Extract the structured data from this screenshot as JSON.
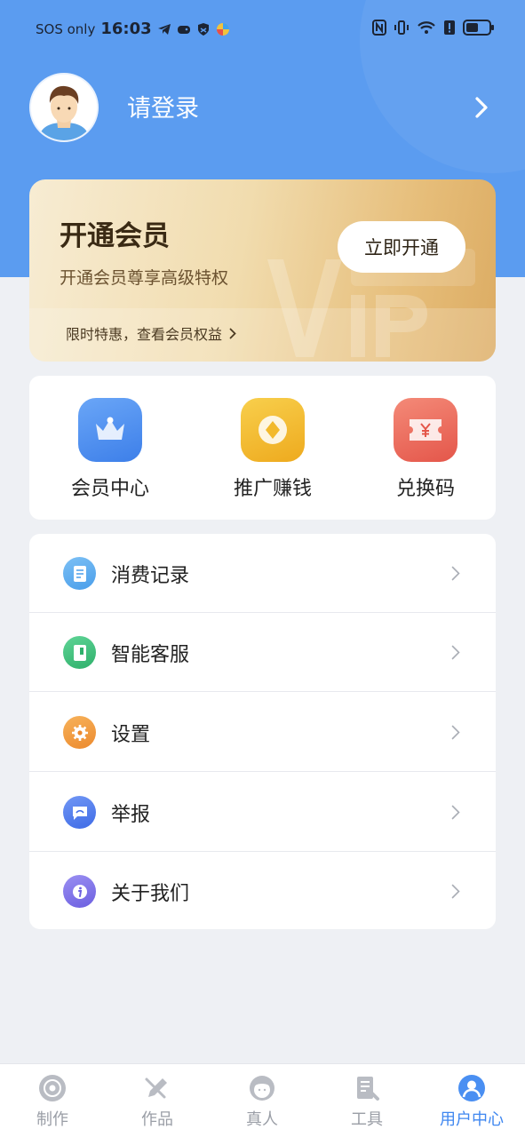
{
  "status_bar": {
    "carrier": "SOS only",
    "time": "16:03",
    "battery_level": 0.55
  },
  "profile": {
    "login_prompt": "请登录"
  },
  "vip": {
    "title": "开通会员",
    "subtitle": "开通会员尊享高级特权",
    "button_label": "立即开通",
    "promo": "限时特惠，查看会员权益",
    "watermark": "VIP会员"
  },
  "quick_actions": [
    {
      "label": "会员中心",
      "icon": "crown-icon",
      "color": "#4f8ef3"
    },
    {
      "label": "推广赚钱",
      "icon": "coin-icon",
      "color": "#f2b92c"
    },
    {
      "label": "兑换码",
      "icon": "ticket-icon",
      "color": "#ee6b5d"
    }
  ],
  "menu": [
    {
      "label": "消费记录",
      "icon": "receipt-icon",
      "color": "#56a8ef"
    },
    {
      "label": "智能客服",
      "icon": "service-book-icon",
      "color": "#3ec07c"
    },
    {
      "label": "设置",
      "icon": "gear-icon",
      "color": "#f09a3e"
    },
    {
      "label": "举报",
      "icon": "report-chat-icon",
      "color": "#4f7df0"
    },
    {
      "label": "关于我们",
      "icon": "info-icon",
      "color": "#7d72e8"
    }
  ],
  "tabs": [
    {
      "label": "制作",
      "icon": "disc-icon",
      "active": false
    },
    {
      "label": "作品",
      "icon": "pencil-icon",
      "active": false
    },
    {
      "label": "真人",
      "icon": "person-face-icon",
      "active": false
    },
    {
      "label": "工具",
      "icon": "tools-icon",
      "active": false
    },
    {
      "label": "用户中心",
      "icon": "user-icon",
      "active": true
    }
  ],
  "colors": {
    "header_blue": "#5b9cf0",
    "active_tab": "#3f87f0",
    "inactive_tab": "#9a9ea6",
    "vip_gold": "#e6bd79"
  }
}
